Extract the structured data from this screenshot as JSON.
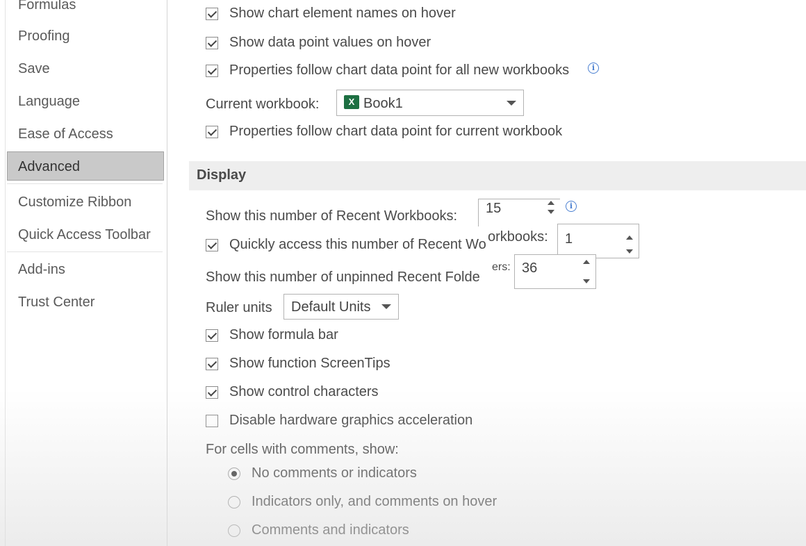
{
  "nav": {
    "items": [
      {
        "label": "Formulas"
      },
      {
        "label": "Proofing"
      },
      {
        "label": "Save"
      },
      {
        "label": "Language"
      },
      {
        "label": "Ease of Access"
      },
      {
        "label": "Advanced",
        "selected": true
      },
      {
        "label": "Customize Ribbon"
      },
      {
        "label": "Quick Access Toolbar"
      },
      {
        "label": "Add-ins"
      },
      {
        "label": "Trust Center"
      }
    ]
  },
  "chart": {
    "show_element_names": {
      "label": "Show chart element names on hover",
      "checked": true
    },
    "show_data_values": {
      "label": "Show data point values on hover",
      "checked": true
    },
    "props_follow_all": {
      "label": "Properties follow chart data point for all new workbooks",
      "checked": true
    },
    "current_workbook_label": "Current workbook:",
    "current_workbook_value": "Book1",
    "props_follow_current": {
      "label": "Properties follow chart data point for current workbook",
      "checked": true
    }
  },
  "display": {
    "header": "Display",
    "recent_workbooks_label": "Show this number of Recent Workbooks:",
    "recent_workbooks_value": "15",
    "quick_access": {
      "label": "Quickly access this number of Recent Wo",
      "checked": true
    },
    "quick_access_overlay_label": "orkbooks:",
    "quick_access_value": "1",
    "recent_folders_label": "Show this number of unpinned Recent Folde",
    "recent_folders_overlay_label": "ers:",
    "recent_folders_value": "36",
    "ruler_label": "Ruler units",
    "ruler_value": "Default Units",
    "formula_bar": {
      "label": "Show formula bar",
      "checked": true
    },
    "function_tips": {
      "label": "Show function ScreenTips",
      "checked": true
    },
    "control_chars": {
      "label": "Show control characters",
      "checked": true
    },
    "disable_hw": {
      "label": "Disable hardware graphics acceleration",
      "checked": false
    },
    "comments_label": "For cells with comments, show:",
    "comments_options": [
      {
        "label": "No comments or indicators",
        "selected": true
      },
      {
        "label": "Indicators only, and comments on hover",
        "selected": false
      },
      {
        "label": "Comments and indicators",
        "selected": false
      }
    ]
  }
}
